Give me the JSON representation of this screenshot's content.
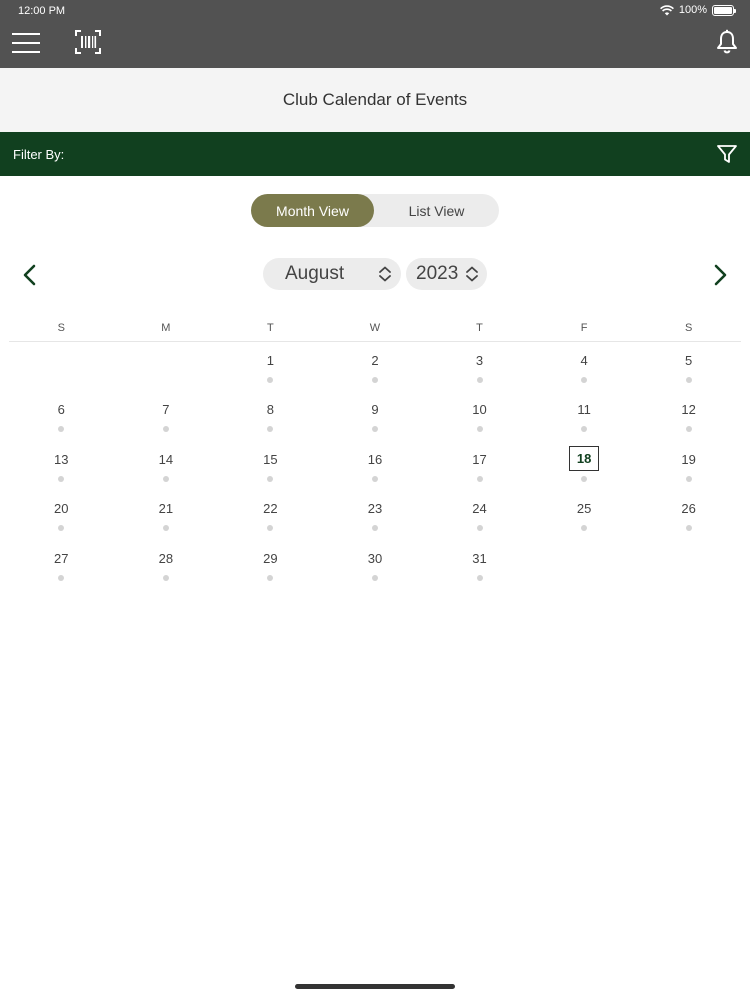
{
  "status_bar": {
    "time": "12:00 PM",
    "battery": "100%"
  },
  "header": {
    "title": "Club Calendar of Events"
  },
  "filter": {
    "label": "Filter By:"
  },
  "view_toggle": {
    "month_label": "Month View",
    "list_label": "List View",
    "selected": "Month View"
  },
  "calendar": {
    "month": "August",
    "year": "2023",
    "weekdays": [
      "S",
      "M",
      "T",
      "W",
      "T",
      "F",
      "S"
    ],
    "first_weekday_index": 2,
    "days_in_month": 31,
    "today": 18
  },
  "colors": {
    "app_bar": "#525252",
    "filter_bar": "#11401f",
    "toggle_active": "#7b7a4c",
    "event_dot": "#d4d4d4"
  },
  "icons": {
    "menu": "hamburger-icon",
    "scan": "barcode-scan-icon",
    "notifications": "bell-icon",
    "filter": "funnel-icon",
    "prev": "chevron-left-icon",
    "next": "chevron-right-icon"
  }
}
